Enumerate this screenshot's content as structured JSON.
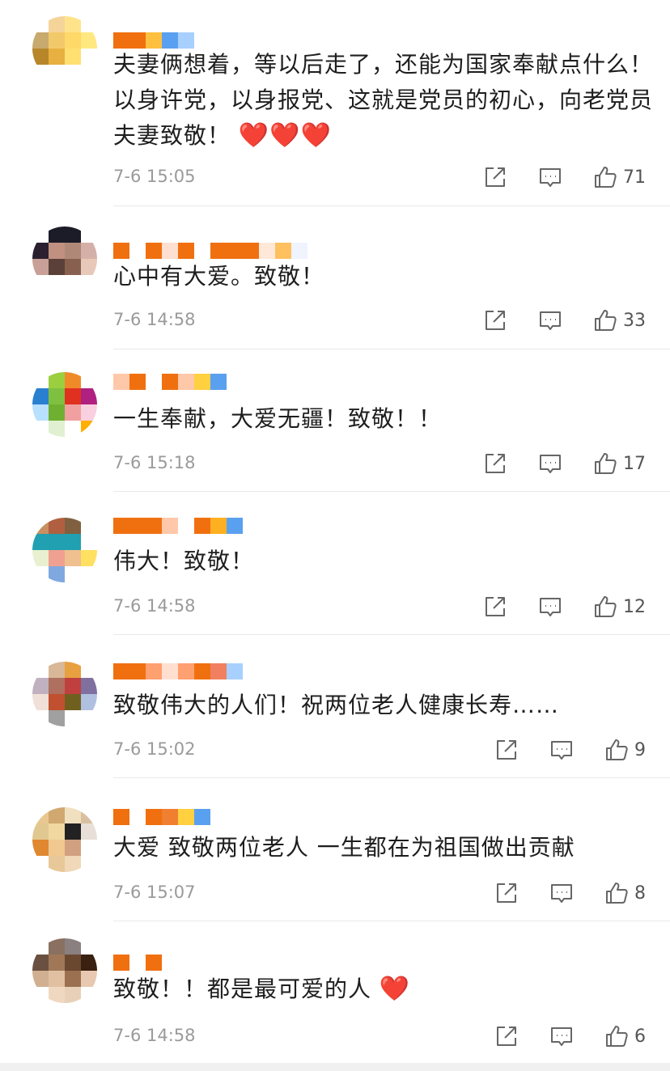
{
  "comments": [
    {
      "text": "夫妻俩想着，等以后走了，还能为国家奉献点什么！ 以身许党，以身报党、这就是党员的初心，向老党员夫妻致敬！",
      "hearts": "❤️❤️❤️",
      "time": "7-6 15:05",
      "likes": "71",
      "avatar_colors": [
        "#ffffff",
        "#f5d49a",
        "#ffe38a",
        "#ffffff",
        "#c8a96e",
        "#f2c96a",
        "#ffd86a",
        "#ffe880",
        "#b8862a",
        "#e8b040",
        "#ffe070",
        "#ffffff",
        "#ffffff",
        "#ffffff",
        "#ffffff",
        "#ffffff"
      ],
      "name_colors": [
        "#f07010",
        "#f07010",
        "#ffc040",
        "#5aa0f0",
        "#a8d0ff"
      ]
    },
    {
      "text": "心中有大爱。致敬！",
      "hearts": "",
      "time": "7-6 14:58",
      "likes": "33",
      "avatar_colors": [
        "#ffffff",
        "#1c1c28",
        "#1c1c28",
        "#ffffff",
        "#2a2030",
        "#c09080",
        "#b08878",
        "#d4b0a8",
        "#c8a098",
        "#5a4038",
        "#886050",
        "#e8c8b8",
        "#ffffff",
        "#ffffff",
        "#ffffff",
        "#ffffff"
      ],
      "name_colors": [
        "#f07010",
        "#ffffff",
        "#f07010",
        "#ffe0d0",
        "#f07010",
        "#ffffff",
        "#f07010",
        "#f07010",
        "#f07010",
        "#ffe8d8",
        "#ffc060",
        "#f0f4ff"
      ]
    },
    {
      "text": "一生奉献，大爱无疆！致敬！！",
      "hearts": "",
      "time": "7-6 15:18",
      "likes": "17",
      "avatar_colors": [
        "#ffffff",
        "#9ccf40",
        "#f08a28",
        "#ffffff",
        "#2a80d0",
        "#80c040",
        "#e03020",
        "#b02080",
        "#b8e0ff",
        "#70b030",
        "#f0a0a0",
        "#f8d0e0",
        "#ffffff",
        "#e0f0d0",
        "#ffffff",
        "#ffb000"
      ],
      "name_colors": [
        "#ffc8a8",
        "#f07010",
        "#ffffff",
        "#f07010",
        "#ffc8a8",
        "#ffd040",
        "#5aa0f0"
      ]
    },
    {
      "text": "伟大！致敬！",
      "hearts": "",
      "time": "7-6 14:58",
      "likes": "12",
      "avatar_colors": [
        "#c89060",
        "#b06040",
        "#806040",
        "#ffffff",
        "#20a0b0",
        "#20a0b0",
        "#20a0b0",
        "#ffffff",
        "#e8f0d0",
        "#f0a090",
        "#f0c090",
        "#ffe060",
        "#ffffff",
        "#80a8e0",
        "#ffffff",
        "#ffffff"
      ],
      "name_colors": [
        "#f07010",
        "#f07010",
        "#f07010",
        "#ffc8a8",
        "#ffffff",
        "#f07010",
        "#ffb020",
        "#5aa0f0"
      ]
    },
    {
      "text": "致敬伟大的人们！祝两位老人健康长寿……",
      "hearts": "",
      "time": "7-6 15:02",
      "likes": "9",
      "avatar_colors": [
        "#ffffff",
        "#d8b898",
        "#e8a040",
        "#ffffff",
        "#c0b0c0",
        "#b07060",
        "#c04040",
        "#8070a0",
        "#f0e0d8",
        "#c05030",
        "#706020",
        "#b0c0e0",
        "#ffffff",
        "#a0a0a0",
        "#ffffff",
        "#ffffff"
      ],
      "name_colors": [
        "#f07010",
        "#f07010",
        "#ffa070",
        "#ffe0d0",
        "#ffa070",
        "#f07010",
        "#f08060",
        "#a8d0ff"
      ]
    },
    {
      "text": "大爱 致敬两位老人 一生都在为祖国做出贡献",
      "hearts": "",
      "time": "7-6 15:07",
      "likes": "8",
      "avatar_colors": [
        "#e8c890",
        "#d0a870",
        "#f0e0c0",
        "#d8c0a0",
        "#e0c890",
        "#f0d8a0",
        "#222222",
        "#e8e0d8",
        "#e08830",
        "#f0c890",
        "#d0a080",
        "#ffffff",
        "#ffffff",
        "#e8c898",
        "#f0d8b8",
        "#ffffff"
      ],
      "name_colors": [
        "#f07010",
        "#ffffff",
        "#f07010",
        "#f08030",
        "#ffd040",
        "#5aa0f0"
      ]
    },
    {
      "text": "致敬！！都是最可爱的人",
      "hearts": "❤️",
      "time": "7-6 14:58",
      "likes": "6",
      "avatar_colors": [
        "#ffffff",
        "#8a7060",
        "#8a8080",
        "#ffffff",
        "#6a5040",
        "#a07858",
        "#6a4830",
        "#3a2010",
        "#d0b090",
        "#e0c0a0",
        "#9a7050",
        "#e8c8b0",
        "#ffffff",
        "#f0d8c0",
        "#e8d0b8",
        "#ffffff"
      ],
      "name_colors": [
        "#f07010",
        "#ffffff",
        "#f07010"
      ]
    }
  ]
}
